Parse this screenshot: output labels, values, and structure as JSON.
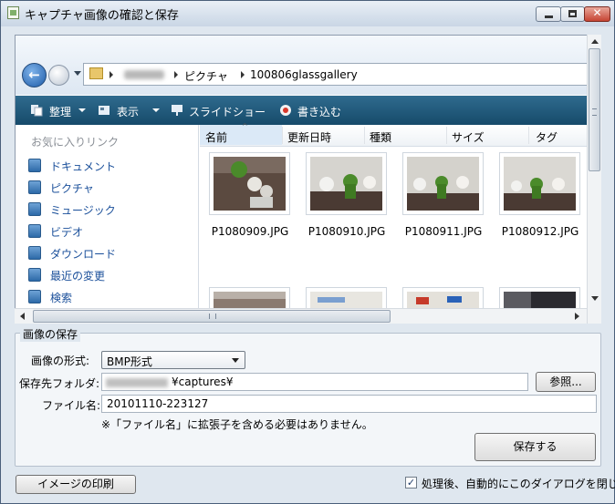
{
  "window": {
    "title": "キャプチャ画像の確認と保存",
    "controls": {
      "minimize": "",
      "maximize": "",
      "close": "✕"
    }
  },
  "address": {
    "crumbs": [
      "ピクチャ",
      "100806glassgallery"
    ]
  },
  "toolbar": {
    "organize": "整理",
    "view": "表示",
    "slideshow": "スライドショー",
    "burn": "書き込む"
  },
  "nav": {
    "favorites_header": "お気に入りリンク",
    "items": [
      "ドキュメント",
      "ピクチャ",
      "ミュージック",
      "ビデオ",
      "ダウンロード",
      "最近の変更",
      "検索"
    ]
  },
  "columns": [
    "名前",
    "更新日時",
    "種類",
    "サイズ",
    "タグ"
  ],
  "files": [
    "P1080909.JPG",
    "P1080910.JPG",
    "P1080911.JPG",
    "P1080912.JPG"
  ],
  "save": {
    "group_title": "画像の保存",
    "format_label": "画像の形式:",
    "format_value": "BMP形式",
    "folder_label": "保存先フォルダ:",
    "folder_value": "¥captures¥",
    "browse_label": "参照...",
    "filename_label": "ファイル名:",
    "filename_value": "20101110-223127",
    "note": "※「ファイル名」に拡張子を含める必要はありません。",
    "save_button": "保存する"
  },
  "footer": {
    "print_button": "イメージの印刷",
    "autoclose_label": "処理後、自動的にこのダイアログを閉じる",
    "autoclose_checked": true,
    "check_mark": "✓"
  },
  "colors": {
    "toolbar": "#1d5577",
    "link": "#1a4f9a",
    "titlebar": "#c9d6e5"
  }
}
